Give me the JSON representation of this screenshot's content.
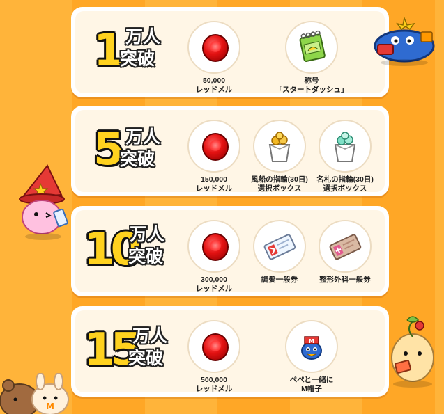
{
  "milestones": [
    {
      "number": "1",
      "unit": "万人",
      "suffix": "突破",
      "rewards": [
        {
          "icon": "red-mel-coin-icon",
          "lines": [
            "50,000",
            "レッドメル"
          ]
        },
        {
          "icon": "title-notebook-icon",
          "lines": [
            "称号",
            "「スタートダッシュ」"
          ]
        }
      ]
    },
    {
      "number": "5",
      "unit": "万人",
      "suffix": "突破",
      "rewards": [
        {
          "icon": "red-mel-coin-icon",
          "lines": [
            "150,000",
            "レッドメル"
          ]
        },
        {
          "icon": "gold-ring-box-icon",
          "lines": [
            "風船の指輪(30日)",
            "選択ボックス"
          ]
        },
        {
          "icon": "mint-ring-box-icon",
          "lines": [
            "名札の指輪(30日)",
            "選択ボックス"
          ]
        }
      ]
    },
    {
      "number": "10",
      "unit": "万人",
      "suffix": "突破",
      "rewards": [
        {
          "icon": "red-mel-coin-icon",
          "lines": [
            "300,000",
            "レッドメル"
          ]
        },
        {
          "icon": "hair-coupon-icon",
          "lines": [
            "調髪一般券"
          ]
        },
        {
          "icon": "face-coupon-icon",
          "lines": [
            "整形外科一般券"
          ]
        }
      ]
    },
    {
      "number": "15",
      "unit": "万人",
      "suffix": "突破",
      "rewards": [
        {
          "icon": "red-mel-coin-icon",
          "lines": [
            "500,000",
            "レッドメル"
          ]
        },
        {
          "icon": "pepe-m-hat-icon",
          "lines": [
            "ぺぺと一緒に",
            "M帽子"
          ]
        }
      ]
    }
  ],
  "colors": {
    "background_stripe_light": "#ffb43a",
    "background_stripe_dark": "#ffa726",
    "panel": "#fff6e6",
    "number_fill": "#ffd21f"
  }
}
